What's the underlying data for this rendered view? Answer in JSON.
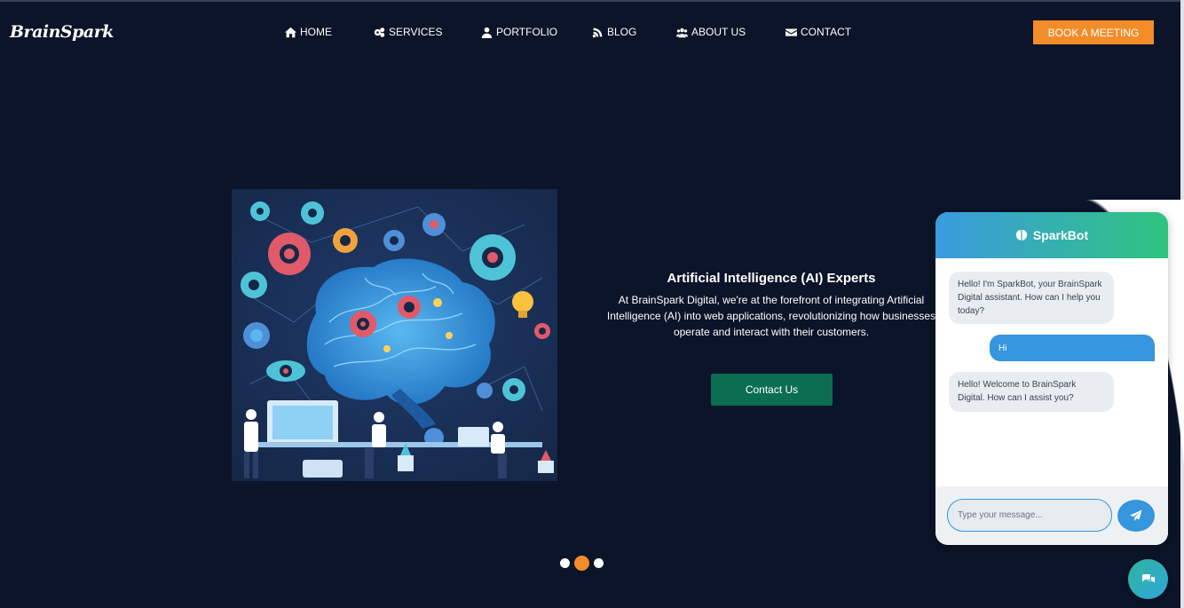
{
  "brand": {
    "logo_text": "BrainSpark"
  },
  "nav": {
    "items": [
      {
        "label": "HOME",
        "icon": "home-icon"
      },
      {
        "label": "SERVICES",
        "icon": "cogs-icon"
      },
      {
        "label": "PORTFOLIO",
        "icon": "user-icon"
      },
      {
        "label": "BLOG",
        "icon": "blog-icon"
      },
      {
        "label": "ABOUT US",
        "icon": "users-icon"
      },
      {
        "label": "CONTACT",
        "icon": "envelope-icon"
      }
    ],
    "cta_label": "BOOK A MEETING"
  },
  "hero": {
    "image_alt": "AI brain illustration",
    "title": "Artificial Intelligence (AI) Experts",
    "description": "At BrainSpark Digital, we're at the forefront of integrating Artificial Intelligence (AI) into web applications, revolutionizing how businesses operate and interact with their customers.",
    "button_label": "Contact Us"
  },
  "carousel": {
    "slide_count": 3,
    "active_index": 1
  },
  "chat": {
    "title": "SparkBot",
    "messages": [
      {
        "from": "bot",
        "text": "Hello! I'm SparkBot, your BrainSpark Digital assistant. How can I help you today?"
      },
      {
        "from": "user",
        "text": "Hi"
      },
      {
        "from": "bot",
        "text": "Hello! Welcome to BrainSpark Digital. How can I assist you?"
      }
    ],
    "input_placeholder": "Type your message..."
  },
  "colors": {
    "background": "#0b1428",
    "accent_orange": "#f28c28",
    "contact_green": "#0a6e4f",
    "chat_blue": "#3595dd",
    "chat_green": "#2fc47e"
  }
}
